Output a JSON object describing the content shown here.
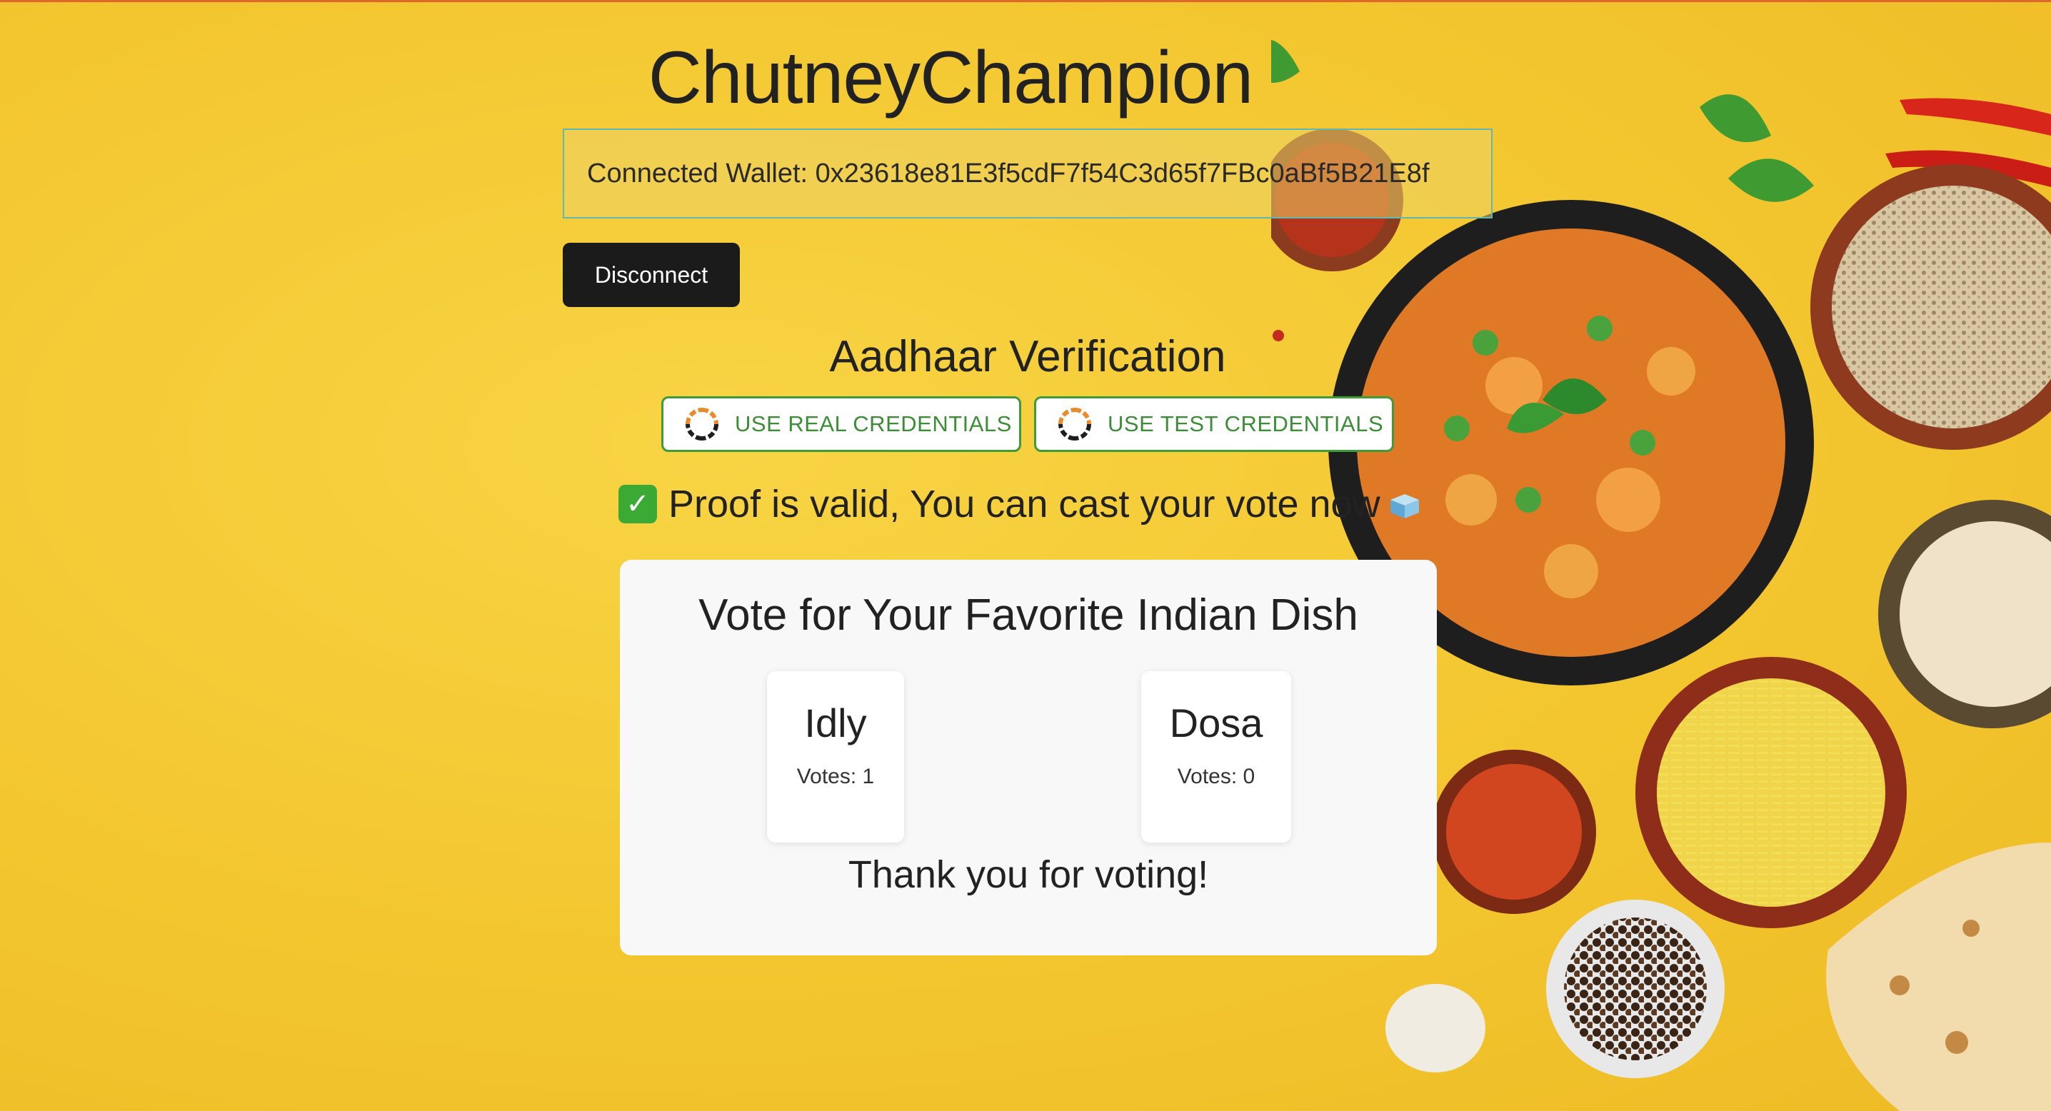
{
  "app": {
    "title": "ChutneyChampion",
    "wallet_text": "Connected Wallet: 0x23618e81E3f5cdF7f54C3d65f7FBc0aBf5B21E8f",
    "disconnect_label": "Disconnect"
  },
  "aadhaar": {
    "title": "Aadhaar Verification",
    "real_button": "USE REAL CREDENTIALS",
    "test_button": "USE TEST CREDENTIALS",
    "proof_message": "Proof is valid, You can cast your vote now"
  },
  "voting": {
    "title": "Vote for Your Favorite Indian Dish",
    "options": [
      {
        "name": "Idly",
        "votes_text": "Votes: 1"
      },
      {
        "name": "Dosa",
        "votes_text": "Votes: 0"
      }
    ],
    "thank_you": "Thank you for voting!"
  },
  "icons": {
    "proof": "check-mark-icon",
    "ballot": "ballot-box-icon",
    "aadhaar_logo": "aadhaar-logo-icon"
  },
  "colors": {
    "background": "#f3c62f",
    "accent_green": "#3f9a3a",
    "dark_button": "#1b1b1b"
  }
}
